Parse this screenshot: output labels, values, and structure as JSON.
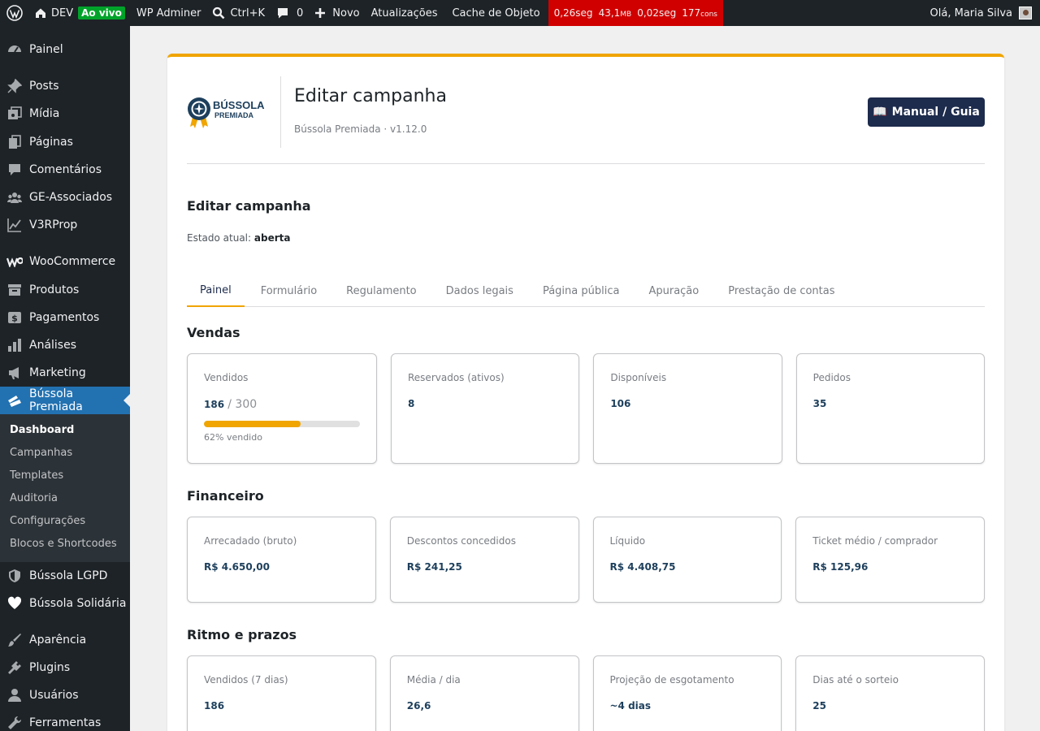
{
  "adminbar": {
    "site": "DEV",
    "live_badge": "Ao vivo",
    "adminer": "WP Adminer",
    "search_shortcut": "Ctrl+K",
    "comments_count": "0",
    "new": "Novo",
    "updates": "Atualizações",
    "object_cache": "Cache de Objeto",
    "perf": {
      "time": "0,26seg",
      "memory": "43,1",
      "memory_unit": "MB",
      "query_time": "0,02seg",
      "queries": "177",
      "queries_unit": "cons"
    },
    "greeting": "Olá, Maria Silva"
  },
  "sidebar": {
    "items": [
      {
        "label": "Painel",
        "icon": "dashboard-icon"
      },
      {
        "label": "Posts",
        "icon": "pin-icon"
      },
      {
        "label": "Mídia",
        "icon": "media-icon"
      },
      {
        "label": "Páginas",
        "icon": "pages-icon"
      },
      {
        "label": "Comentários",
        "icon": "comment-icon"
      },
      {
        "label": "GE-Associados",
        "icon": "groups-icon"
      },
      {
        "label": "V3RProp",
        "icon": "chart-line-icon"
      },
      {
        "label": "WooCommerce",
        "icon": "woo-icon"
      },
      {
        "label": "Produtos",
        "icon": "archive-icon"
      },
      {
        "label": "Pagamentos",
        "icon": "money-icon"
      },
      {
        "label": "Análises",
        "icon": "bar-chart-icon"
      },
      {
        "label": "Marketing",
        "icon": "megaphone-icon"
      },
      {
        "label": "Bússola Premiada",
        "icon": "tickets-icon"
      },
      {
        "label": "Bússola LGPD",
        "icon": "shield-icon"
      },
      {
        "label": "Bússola Solidária",
        "icon": "heart-icon"
      },
      {
        "label": "Aparência",
        "icon": "brush-icon"
      },
      {
        "label": "Plugins",
        "icon": "plugin-icon"
      },
      {
        "label": "Usuários",
        "icon": "user-icon"
      },
      {
        "label": "Ferramentas",
        "icon": "wrench-icon"
      }
    ],
    "submenu": [
      "Dashboard",
      "Campanhas",
      "Templates",
      "Auditoria",
      "Configurações",
      "Blocos e Shortcodes"
    ]
  },
  "header": {
    "logo_text": "BÚSSOLA",
    "logo_subtext": "PREMIADA",
    "title": "Editar campanha",
    "subtitle": "Bússola Premiada · v1.12.0",
    "guide_button": "Manual / Guia",
    "guide_emoji": "📖"
  },
  "campaign": {
    "title": "Editar campanha",
    "state_label": "Estado atual:",
    "state_value": "aberta"
  },
  "tabs": [
    "Painel",
    "Formulário",
    "Regulamento",
    "Dados legais",
    "Página pública",
    "Apuração",
    "Prestação de contas"
  ],
  "sections": {
    "vendas": {
      "title": "Vendas",
      "sold_label": "Vendidos",
      "sold_value": "186",
      "sold_total": "/ 300",
      "progress_fraction": 0.62,
      "progress_caption": "62% vendido",
      "reserved_label": "Reservados (ativos)",
      "reserved_value": "8",
      "available_label": "Disponíveis",
      "available_value": "106",
      "orders_label": "Pedidos",
      "orders_value": "35"
    },
    "financeiro": {
      "title": "Financeiro",
      "cards": [
        {
          "label": "Arrecadado (bruto)",
          "value": "R$ 4.650,00"
        },
        {
          "label": "Descontos concedidos",
          "value": "R$ 241,25"
        },
        {
          "label": "Líquido",
          "value": "R$ 4.408,75"
        },
        {
          "label": "Ticket médio / comprador",
          "value": "R$ 125,96"
        }
      ]
    },
    "ritmo": {
      "title": "Ritmo e prazos",
      "cards": [
        {
          "label": "Vendidos (7 dias)",
          "value": "186"
        },
        {
          "label": "Média / dia",
          "value": "26,6"
        },
        {
          "label": "Projeção de esgotamento",
          "value": "~4 dias"
        },
        {
          "label": "Dias até o sorteio",
          "value": "25"
        }
      ]
    }
  },
  "colors": {
    "accent": "#f0a500",
    "brand_navy": "#1d2b4c",
    "admin_dark": "#1d2327",
    "active_blue": "#2271b1",
    "perf_red": "#d00000",
    "live_green": "#00a32a"
  }
}
